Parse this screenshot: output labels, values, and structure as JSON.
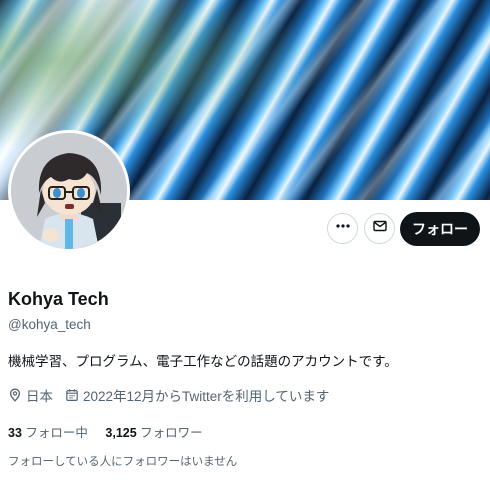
{
  "profile": {
    "name": "Kohya Tech",
    "handle": "@kohya_tech",
    "bio": "機械学習、プログラム、電子工作などの話題のアカウントです。",
    "location": "日本",
    "joined": "2022年12月からTwitterを利用しています"
  },
  "stats": {
    "following_count": "33",
    "following_label": "フォロー中",
    "followers_count": "3,125",
    "followers_label": "フォロワー"
  },
  "actions": {
    "follow_label": "フォロー",
    "more_icon": "more-icon",
    "message_icon": "mail-icon"
  },
  "note": "フォローしている人にフォロワーはいません",
  "colors": {
    "text": "#0f1419",
    "secondary": "#536471",
    "button": "#0f1419",
    "border": "#cfd9de"
  }
}
